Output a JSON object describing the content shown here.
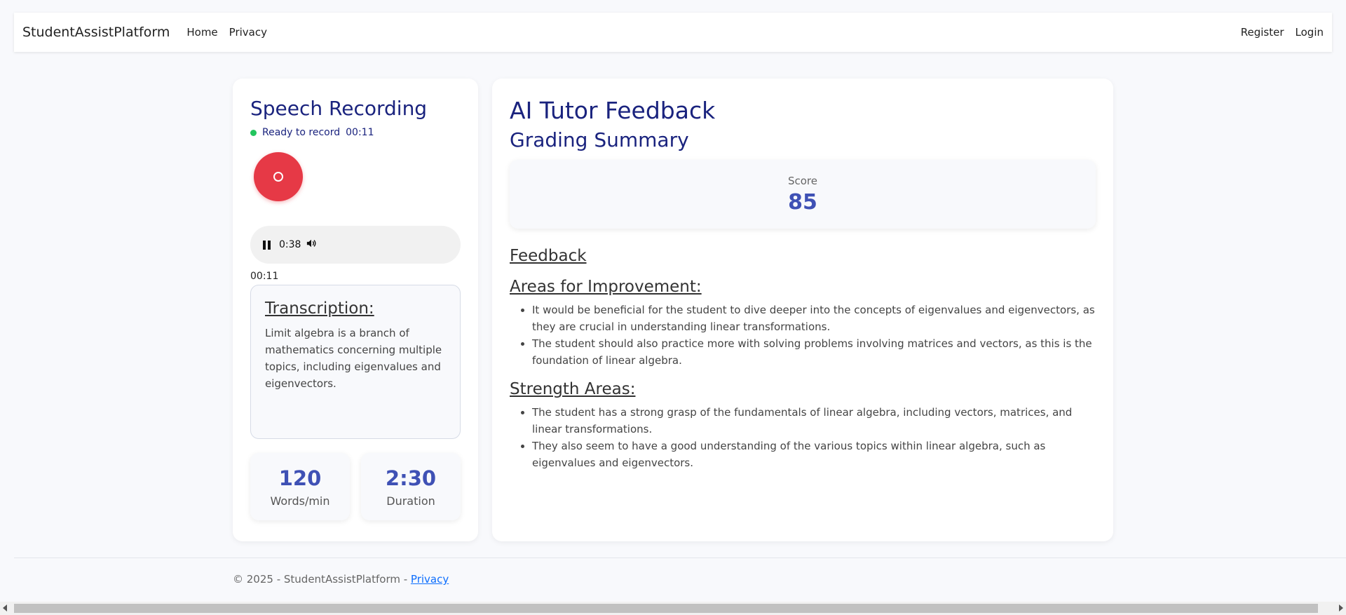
{
  "nav": {
    "brand": "StudentAssistPlatform",
    "links": [
      "Home",
      "Privacy"
    ],
    "right_links": [
      "Register",
      "Login"
    ]
  },
  "recording": {
    "title": "Speech Recording",
    "status": "Ready to record",
    "status_timer": "00:11",
    "status_color": "#22c55e",
    "record_color": "#e63946",
    "player_time": "0:38",
    "elapsed": "00:11",
    "transcription_title": "Transcription:",
    "transcription_text": "Limit algebra is a branch of mathematics concerning multiple topics, including eigenvalues and eigenvectors.",
    "stats": [
      {
        "value": "120",
        "label": "Words/min"
      },
      {
        "value": "2:30",
        "label": "Duration"
      }
    ]
  },
  "feedback": {
    "title": "AI Tutor Feedback",
    "subtitle": "Grading Summary",
    "score_label": "Score",
    "score_value": "85",
    "feedback_heading": "Feedback",
    "improvement_heading": "Areas for Improvement:",
    "improvement_items": [
      "It would be beneficial for the student to dive deeper into the concepts of eigenvalues and eigenvectors, as they are crucial in understanding linear transformations.",
      "The student should also practice more with solving problems involving matrices and vectors, as this is the foundation of linear algebra."
    ],
    "strength_heading": "Strength Areas:",
    "strength_items": [
      "The student has a strong grasp of the fundamentals of linear algebra, including vectors, matrices, and linear transformations.",
      "They also seem to have a good understanding of the various topics within linear algebra, such as eigenvalues and eigenvectors."
    ]
  },
  "footer": {
    "text": "© 2025 - StudentAssistPlatform - ",
    "link": "Privacy"
  },
  "colors": {
    "accent": "#3f51b5",
    "heading": "#1a237e",
    "link": "#0d6efd"
  }
}
